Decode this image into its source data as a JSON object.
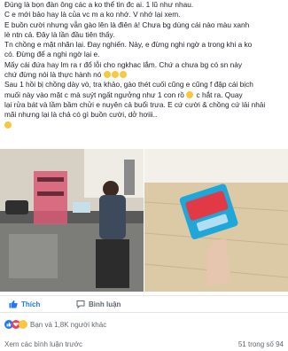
{
  "post": {
    "lines": [
      "Đúng là bọn đàn ông các a ko thể tin đc ai. 1 lũ như nhau.",
      "C e mới bảo hay là của vc m a ko nhớ. V nhớ lại xem.",
      "E buồn cười nhưng vẫn gào lên là điên à! Chưa bg dùng cái nào màu xanh",
      "lè ntn cả. Đây là lần đầu tiên thấy.",
      "Tn chồng e mặt nhăn lại. Đay nghiến. Này, e đừng nghi ngờ a trong khi a ko",
      "có. Đừng để a nghi ngờ lại e.",
      "Mấy cái đứa hay lm ra r đổ lỗi cho ngkhac lắm. Chứ a chưa bg có sn này",
      "chứ đừng nói là thực hành nó",
      "Sau 1 hồi bị chồng dày vò, tra khảo, gào thét cuối cũng e cũng f đập cái bịch",
      "muối này vào mặt c mà suýt ngất ngưởng như 1 con rồ",
      "lại rửa bát và lầm bầm chửi e nuyên cả buổi trưa. E cứ cười & chồng cứ lải nhải",
      "mãi nhưng lại là chả có gì buồn cười, dở hơiii..",
      ""
    ],
    "line9_suffix": "c hắt ra. Quay",
    "emojis": [
      "laughing-emoji",
      "laughing-emoji",
      "laughing-emoji"
    ]
  },
  "actions": {
    "like_label": "Thích",
    "comment_label": "Bình luận"
  },
  "reactions": {
    "summary": "Bạn và 1,8K người khác"
  },
  "comments": {
    "view_more": "Xem các bình luận trước",
    "count": "51 trong số 94"
  },
  "colors": {
    "like_blue": "#2078f4",
    "love_red": "#f33e58",
    "haha_yellow": "#f7c940",
    "text_gray": "#606770"
  }
}
